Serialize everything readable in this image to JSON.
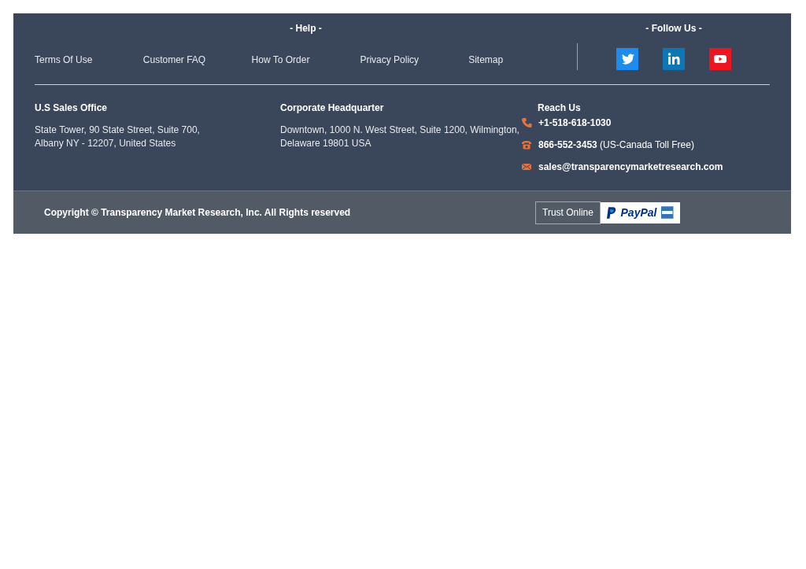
{
  "help": {
    "title": "- Help -",
    "links": [
      "Terms Of Use",
      "Customer FAQ",
      "How To Order",
      "Privacy Policy",
      "Sitemap"
    ]
  },
  "follow": {
    "title": "- Follow Us -",
    "icons": [
      {
        "kind": "twitter"
      },
      {
        "kind": "linkedin"
      },
      {
        "kind": "youtube"
      }
    ]
  },
  "offices": [
    {
      "title": "U.S Sales Office",
      "address": "State Tower, 90 State Street, Suite 700,\nAlbany NY - 12207, United States"
    },
    {
      "title": "Corporate Headquarter",
      "address": "Downtown, 1000 N. West Street, Suite 1200, Wilmington,\nDelaware 19801 USA"
    }
  ],
  "reach": {
    "title": "Reach Us",
    "contacts": [
      {
        "kind": "phone",
        "text": "+1-518-618-1030"
      },
      {
        "kind": "tollfree",
        "text": "**866-552-3453** (US-Canada Toll Free)"
      },
      {
        "kind": "email",
        "text": "sales@transparencymarketresearch.com"
      }
    ]
  },
  "copyright": "Copyright © Transparency Market Research, Inc. All Rights reserved",
  "trust": {
    "label": "Trust Online",
    "paypal": "PayPal"
  }
}
